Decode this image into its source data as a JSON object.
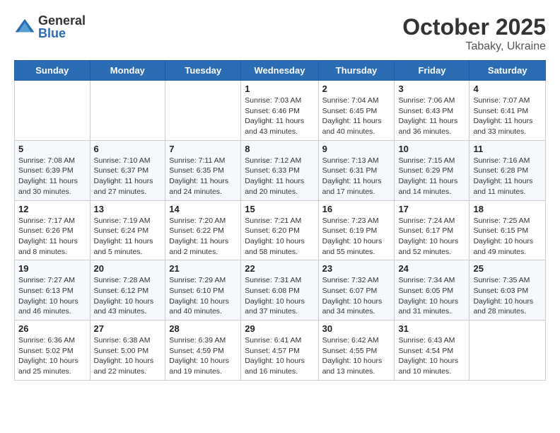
{
  "header": {
    "logo_general": "General",
    "logo_blue": "Blue",
    "month_title": "October 2025",
    "location": "Tabaky, Ukraine"
  },
  "days_of_week": [
    "Sunday",
    "Monday",
    "Tuesday",
    "Wednesday",
    "Thursday",
    "Friday",
    "Saturday"
  ],
  "weeks": [
    [
      {
        "num": "",
        "info": ""
      },
      {
        "num": "",
        "info": ""
      },
      {
        "num": "",
        "info": ""
      },
      {
        "num": "1",
        "info": "Sunrise: 7:03 AM\nSunset: 6:46 PM\nDaylight: 11 hours and 43 minutes."
      },
      {
        "num": "2",
        "info": "Sunrise: 7:04 AM\nSunset: 6:45 PM\nDaylight: 11 hours and 40 minutes."
      },
      {
        "num": "3",
        "info": "Sunrise: 7:06 AM\nSunset: 6:43 PM\nDaylight: 11 hours and 36 minutes."
      },
      {
        "num": "4",
        "info": "Sunrise: 7:07 AM\nSunset: 6:41 PM\nDaylight: 11 hours and 33 minutes."
      }
    ],
    [
      {
        "num": "5",
        "info": "Sunrise: 7:08 AM\nSunset: 6:39 PM\nDaylight: 11 hours and 30 minutes."
      },
      {
        "num": "6",
        "info": "Sunrise: 7:10 AM\nSunset: 6:37 PM\nDaylight: 11 hours and 27 minutes."
      },
      {
        "num": "7",
        "info": "Sunrise: 7:11 AM\nSunset: 6:35 PM\nDaylight: 11 hours and 24 minutes."
      },
      {
        "num": "8",
        "info": "Sunrise: 7:12 AM\nSunset: 6:33 PM\nDaylight: 11 hours and 20 minutes."
      },
      {
        "num": "9",
        "info": "Sunrise: 7:13 AM\nSunset: 6:31 PM\nDaylight: 11 hours and 17 minutes."
      },
      {
        "num": "10",
        "info": "Sunrise: 7:15 AM\nSunset: 6:29 PM\nDaylight: 11 hours and 14 minutes."
      },
      {
        "num": "11",
        "info": "Sunrise: 7:16 AM\nSunset: 6:28 PM\nDaylight: 11 hours and 11 minutes."
      }
    ],
    [
      {
        "num": "12",
        "info": "Sunrise: 7:17 AM\nSunset: 6:26 PM\nDaylight: 11 hours and 8 minutes."
      },
      {
        "num": "13",
        "info": "Sunrise: 7:19 AM\nSunset: 6:24 PM\nDaylight: 11 hours and 5 minutes."
      },
      {
        "num": "14",
        "info": "Sunrise: 7:20 AM\nSunset: 6:22 PM\nDaylight: 11 hours and 2 minutes."
      },
      {
        "num": "15",
        "info": "Sunrise: 7:21 AM\nSunset: 6:20 PM\nDaylight: 10 hours and 58 minutes."
      },
      {
        "num": "16",
        "info": "Sunrise: 7:23 AM\nSunset: 6:19 PM\nDaylight: 10 hours and 55 minutes."
      },
      {
        "num": "17",
        "info": "Sunrise: 7:24 AM\nSunset: 6:17 PM\nDaylight: 10 hours and 52 minutes."
      },
      {
        "num": "18",
        "info": "Sunrise: 7:25 AM\nSunset: 6:15 PM\nDaylight: 10 hours and 49 minutes."
      }
    ],
    [
      {
        "num": "19",
        "info": "Sunrise: 7:27 AM\nSunset: 6:13 PM\nDaylight: 10 hours and 46 minutes."
      },
      {
        "num": "20",
        "info": "Sunrise: 7:28 AM\nSunset: 6:12 PM\nDaylight: 10 hours and 43 minutes."
      },
      {
        "num": "21",
        "info": "Sunrise: 7:29 AM\nSunset: 6:10 PM\nDaylight: 10 hours and 40 minutes."
      },
      {
        "num": "22",
        "info": "Sunrise: 7:31 AM\nSunset: 6:08 PM\nDaylight: 10 hours and 37 minutes."
      },
      {
        "num": "23",
        "info": "Sunrise: 7:32 AM\nSunset: 6:07 PM\nDaylight: 10 hours and 34 minutes."
      },
      {
        "num": "24",
        "info": "Sunrise: 7:34 AM\nSunset: 6:05 PM\nDaylight: 10 hours and 31 minutes."
      },
      {
        "num": "25",
        "info": "Sunrise: 7:35 AM\nSunset: 6:03 PM\nDaylight: 10 hours and 28 minutes."
      }
    ],
    [
      {
        "num": "26",
        "info": "Sunrise: 6:36 AM\nSunset: 5:02 PM\nDaylight: 10 hours and 25 minutes."
      },
      {
        "num": "27",
        "info": "Sunrise: 6:38 AM\nSunset: 5:00 PM\nDaylight: 10 hours and 22 minutes."
      },
      {
        "num": "28",
        "info": "Sunrise: 6:39 AM\nSunset: 4:59 PM\nDaylight: 10 hours and 19 minutes."
      },
      {
        "num": "29",
        "info": "Sunrise: 6:41 AM\nSunset: 4:57 PM\nDaylight: 10 hours and 16 minutes."
      },
      {
        "num": "30",
        "info": "Sunrise: 6:42 AM\nSunset: 4:55 PM\nDaylight: 10 hours and 13 minutes."
      },
      {
        "num": "31",
        "info": "Sunrise: 6:43 AM\nSunset: 4:54 PM\nDaylight: 10 hours and 10 minutes."
      },
      {
        "num": "",
        "info": ""
      }
    ]
  ]
}
